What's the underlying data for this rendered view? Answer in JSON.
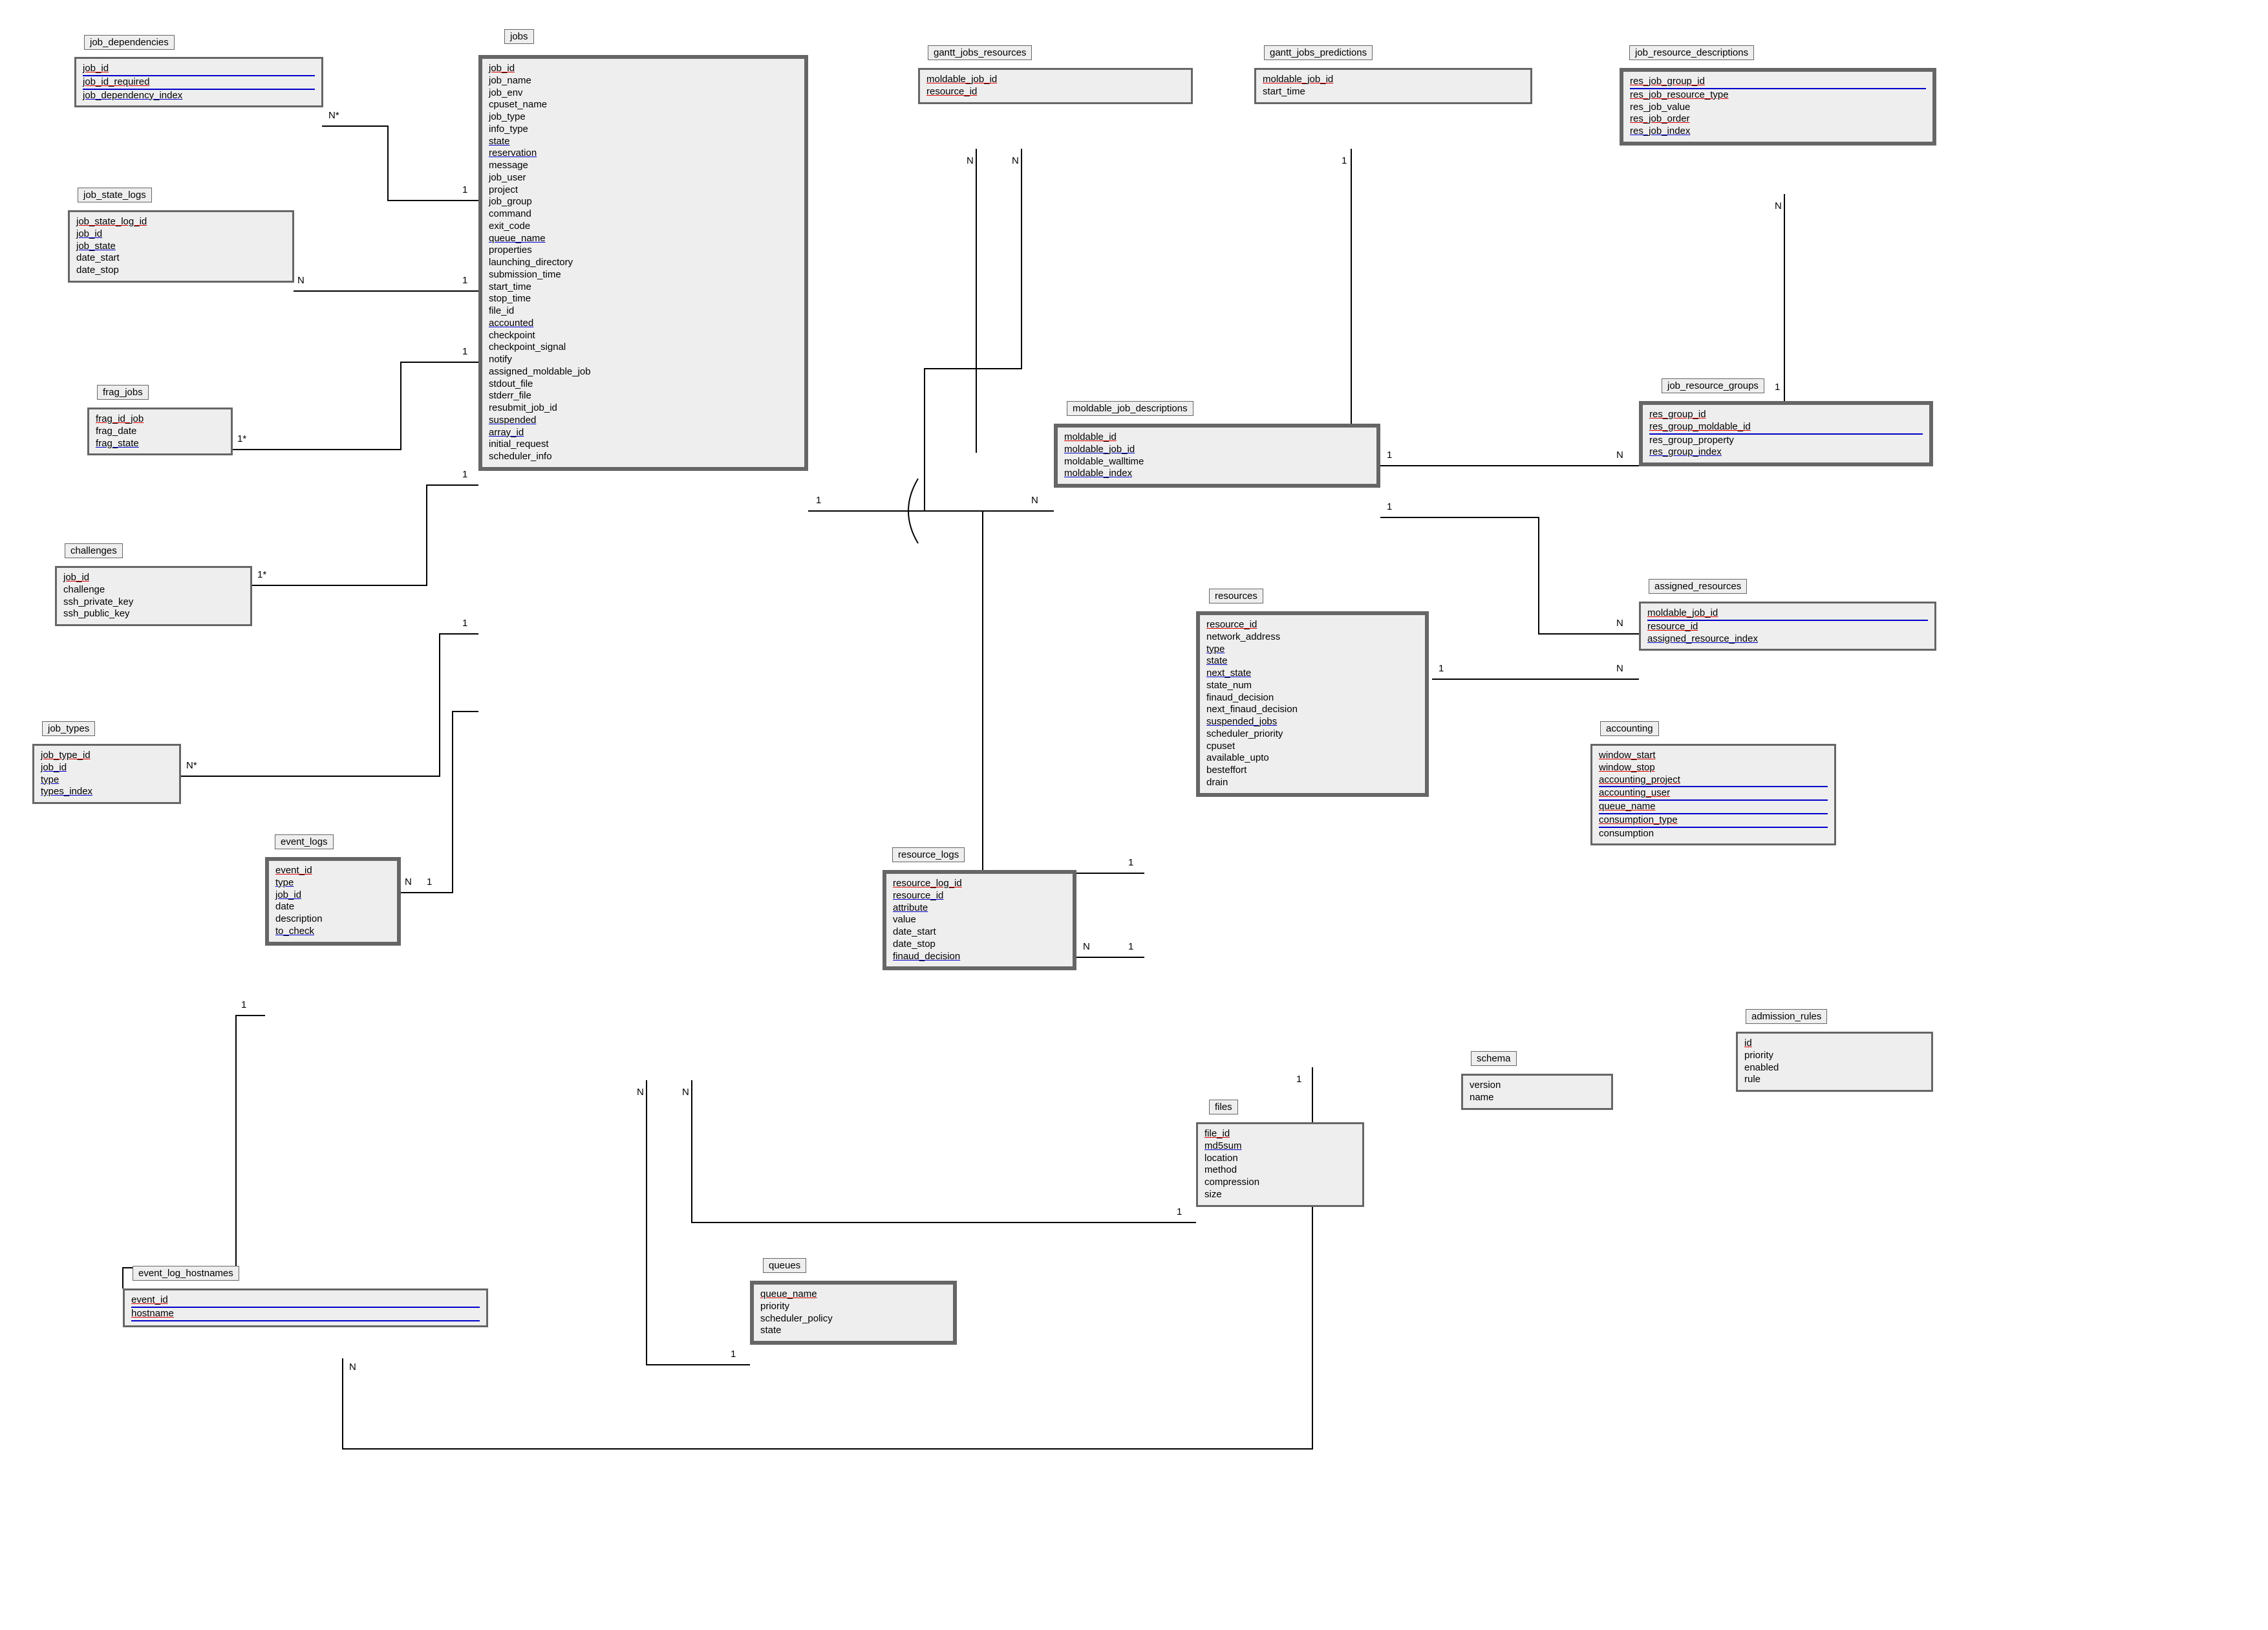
{
  "entities": {
    "job_dependencies": {
      "title": "job_dependencies",
      "fields": [
        {
          "name": "job_id",
          "style": "pkidx"
        },
        {
          "name": "job_id_required",
          "style": "pkidx"
        },
        {
          "name": "job_dependency_index",
          "style": "idx"
        }
      ]
    },
    "job_state_logs": {
      "title": "job_state_logs",
      "fields": [
        {
          "name": "job_state_log_id",
          "style": "pk"
        },
        {
          "name": "job_id",
          "style": "idx"
        },
        {
          "name": "job_state",
          "style": "idx"
        },
        {
          "name": "date_start",
          "style": ""
        },
        {
          "name": "date_stop",
          "style": ""
        }
      ]
    },
    "frag_jobs": {
      "title": "frag_jobs",
      "fields": [
        {
          "name": "frag_id_job",
          "style": "pk"
        },
        {
          "name": "frag_date",
          "style": ""
        },
        {
          "name": "frag_state",
          "style": "idx"
        }
      ]
    },
    "challenges": {
      "title": "challenges",
      "fields": [
        {
          "name": "job_id",
          "style": "pk"
        },
        {
          "name": "challenge",
          "style": ""
        },
        {
          "name": "ssh_private_key",
          "style": ""
        },
        {
          "name": "ssh_public_key",
          "style": ""
        }
      ]
    },
    "job_types": {
      "title": "job_types",
      "fields": [
        {
          "name": "job_type_id",
          "style": "pk"
        },
        {
          "name": "job_id",
          "style": "idx"
        },
        {
          "name": "type",
          "style": "idx"
        },
        {
          "name": "types_index",
          "style": "idx"
        }
      ]
    },
    "event_logs": {
      "title": "event_logs",
      "fields": [
        {
          "name": "event_id",
          "style": "pk"
        },
        {
          "name": "type",
          "style": "idx"
        },
        {
          "name": "job_id",
          "style": "idx"
        },
        {
          "name": "date",
          "style": ""
        },
        {
          "name": "description",
          "style": ""
        },
        {
          "name": "to_check",
          "style": "idx"
        }
      ]
    },
    "event_log_hostnames": {
      "title": "event_log_hostnames",
      "fields": [
        {
          "name": "event_id",
          "style": "pkidx"
        },
        {
          "name": "hostname",
          "style": "pkidx"
        }
      ]
    },
    "jobs": {
      "title": "jobs",
      "fields": [
        {
          "name": "job_id",
          "style": "pk"
        },
        {
          "name": "job_name",
          "style": ""
        },
        {
          "name": "job_env",
          "style": ""
        },
        {
          "name": "cpuset_name",
          "style": ""
        },
        {
          "name": "job_type",
          "style": ""
        },
        {
          "name": "info_type",
          "style": ""
        },
        {
          "name": "state",
          "style": "idx"
        },
        {
          "name": "reservation",
          "style": "idx"
        },
        {
          "name": "message",
          "style": ""
        },
        {
          "name": "job_user",
          "style": ""
        },
        {
          "name": "project",
          "style": ""
        },
        {
          "name": "job_group",
          "style": ""
        },
        {
          "name": "command",
          "style": ""
        },
        {
          "name": "exit_code",
          "style": ""
        },
        {
          "name": "queue_name",
          "style": "idx"
        },
        {
          "name": "properties",
          "style": ""
        },
        {
          "name": "launching_directory",
          "style": ""
        },
        {
          "name": "submission_time",
          "style": ""
        },
        {
          "name": "start_time",
          "style": ""
        },
        {
          "name": "stop_time",
          "style": ""
        },
        {
          "name": "file_id",
          "style": ""
        },
        {
          "name": "accounted",
          "style": "idx"
        },
        {
          "name": "checkpoint",
          "style": ""
        },
        {
          "name": "checkpoint_signal",
          "style": ""
        },
        {
          "name": "notify",
          "style": ""
        },
        {
          "name": "assigned_moldable_job",
          "style": ""
        },
        {
          "name": "stdout_file",
          "style": ""
        },
        {
          "name": "stderr_file",
          "style": ""
        },
        {
          "name": "resubmit_job_id",
          "style": ""
        },
        {
          "name": "suspended",
          "style": "idx"
        },
        {
          "name": "array_id",
          "style": "idx"
        },
        {
          "name": "initial_request",
          "style": ""
        },
        {
          "name": "scheduler_info",
          "style": ""
        }
      ]
    },
    "gantt_jobs_resources": {
      "title": "gantt_jobs_resources",
      "fields": [
        {
          "name": "moldable_job_id",
          "style": "pk"
        },
        {
          "name": "resource_id",
          "style": "pk"
        }
      ]
    },
    "gantt_jobs_predictions": {
      "title": "gantt_jobs_predictions",
      "fields": [
        {
          "name": "moldable_job_id",
          "style": "pk"
        },
        {
          "name": "start_time",
          "style": ""
        }
      ]
    },
    "job_resource_descriptions": {
      "title": "job_resource_descriptions",
      "fields": [
        {
          "name": "res_job_group_id",
          "style": "pkidx"
        },
        {
          "name": "res_job_resource_type",
          "style": "pk"
        },
        {
          "name": "res_job_value",
          "style": ""
        },
        {
          "name": "res_job_order",
          "style": "pk"
        },
        {
          "name": "res_job_index",
          "style": "idx"
        }
      ]
    },
    "moldable_job_descriptions": {
      "title": "moldable_job_descriptions",
      "fields": [
        {
          "name": "moldable_id",
          "style": "pk"
        },
        {
          "name": "moldable_job_id",
          "style": "idx"
        },
        {
          "name": "moldable_walltime",
          "style": ""
        },
        {
          "name": "moldable_index",
          "style": "idx"
        }
      ]
    },
    "job_resource_groups": {
      "title": "job_resource_groups",
      "fields": [
        {
          "name": "res_group_id",
          "style": "pk"
        },
        {
          "name": "res_group_moldable_id",
          "style": "pkidx"
        },
        {
          "name": "res_group_property",
          "style": ""
        },
        {
          "name": "res_group_index",
          "style": "idx"
        }
      ]
    },
    "assigned_resources": {
      "title": "assigned_resources",
      "fields": [
        {
          "name": "moldable_job_id",
          "style": "pkidx"
        },
        {
          "name": "resource_id",
          "style": "pk"
        },
        {
          "name": "assigned_resource_index",
          "style": "idx"
        }
      ]
    },
    "resources": {
      "title": "resources",
      "fields": [
        {
          "name": "resource_id",
          "style": "pk"
        },
        {
          "name": "network_address",
          "style": ""
        },
        {
          "name": "type",
          "style": "idx"
        },
        {
          "name": "state",
          "style": "idx"
        },
        {
          "name": "next_state",
          "style": "idx"
        },
        {
          "name": "state_num",
          "style": ""
        },
        {
          "name": "finaud_decision",
          "style": ""
        },
        {
          "name": "next_finaud_decision",
          "style": ""
        },
        {
          "name": "suspended_jobs",
          "style": "idx"
        },
        {
          "name": "scheduler_priority",
          "style": ""
        },
        {
          "name": "cpuset",
          "style": ""
        },
        {
          "name": "available_upto",
          "style": ""
        },
        {
          "name": "besteffort",
          "style": ""
        },
        {
          "name": "drain",
          "style": ""
        }
      ]
    },
    "accounting": {
      "title": "accounting",
      "fields": [
        {
          "name": "window_start",
          "style": "pk"
        },
        {
          "name": "window_stop",
          "style": "pk"
        },
        {
          "name": "accounting_project",
          "style": "pkidx"
        },
        {
          "name": "accounting_user",
          "style": "pkidx"
        },
        {
          "name": "queue_name",
          "style": "pkidx"
        },
        {
          "name": "consumption_type",
          "style": "pkidx"
        },
        {
          "name": "consumption",
          "style": ""
        }
      ]
    },
    "resource_logs": {
      "title": "resource_logs",
      "fields": [
        {
          "name": "resource_log_id",
          "style": "pk"
        },
        {
          "name": "resource_id",
          "style": "idx"
        },
        {
          "name": "attribute",
          "style": "idx"
        },
        {
          "name": "value",
          "style": ""
        },
        {
          "name": "date_start",
          "style": ""
        },
        {
          "name": "date_stop",
          "style": ""
        },
        {
          "name": "finaud_decision",
          "style": "idx"
        }
      ]
    },
    "admission_rules": {
      "title": "admission_rules",
      "fields": [
        {
          "name": "id",
          "style": "pk"
        },
        {
          "name": "priority",
          "style": ""
        },
        {
          "name": "enabled",
          "style": ""
        },
        {
          "name": "rule",
          "style": ""
        }
      ]
    },
    "schema": {
      "title": "schema",
      "fields": [
        {
          "name": "version",
          "style": ""
        },
        {
          "name": "name",
          "style": ""
        }
      ]
    },
    "files": {
      "title": "files",
      "fields": [
        {
          "name": "file_id",
          "style": "pk"
        },
        {
          "name": "md5sum",
          "style": "idx"
        },
        {
          "name": "location",
          "style": ""
        },
        {
          "name": "method",
          "style": ""
        },
        {
          "name": "compression",
          "style": ""
        },
        {
          "name": "size",
          "style": ""
        }
      ]
    },
    "queues": {
      "title": "queues",
      "fields": [
        {
          "name": "queue_name",
          "style": "pk"
        },
        {
          "name": "priority",
          "style": ""
        },
        {
          "name": "scheduler_policy",
          "style": ""
        },
        {
          "name": "state",
          "style": ""
        }
      ]
    }
  },
  "cardinalities": {
    "c1": "1",
    "cN": "N",
    "cNs": "N*",
    "c1s": "1*"
  }
}
